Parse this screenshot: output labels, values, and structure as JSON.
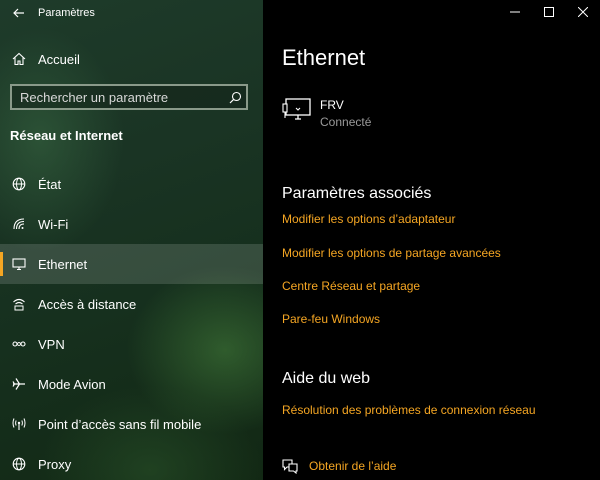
{
  "app": {
    "title": "Paramètres"
  },
  "sidebar": {
    "home_label": "Accueil",
    "search": {
      "placeholder": "Rechercher un paramètre",
      "value": ""
    },
    "section_title": "Réseau et Internet",
    "items": [
      {
        "label": "État",
        "icon": "globe-icon",
        "active": false
      },
      {
        "label": "Wi-Fi",
        "icon": "wifi-icon",
        "active": false
      },
      {
        "label": "Ethernet",
        "icon": "ethernet-icon",
        "active": true
      },
      {
        "label": "Accès à distance",
        "icon": "dialup-icon",
        "active": false
      },
      {
        "label": "VPN",
        "icon": "vpn-icon",
        "active": false
      },
      {
        "label": "Mode Avion",
        "icon": "airplane-icon",
        "active": false
      },
      {
        "label": "Point d’accès sans fil mobile",
        "icon": "hotspot-icon",
        "active": false
      },
      {
        "label": "Proxy",
        "icon": "globe-icon",
        "active": false
      }
    ]
  },
  "main": {
    "page_title": "Ethernet",
    "network": {
      "name": "FRV",
      "status": "Connecté",
      "icon": "network-computer-icon"
    },
    "related": {
      "title": "Paramètres associés",
      "links": [
        "Modifier les options d’adaptateur",
        "Modifier les options de partage avancées",
        "Centre Réseau et partage",
        "Pare-feu Windows"
      ]
    },
    "web_help": {
      "title": "Aide du web",
      "links": [
        "Résolution des problèmes de connexion réseau"
      ]
    },
    "get_help": "Obtenir de l’aide"
  },
  "colors": {
    "accent": "#f5a623",
    "main_bg": "#000000",
    "sidebar_bg": "#1a3424",
    "muted_text": "#9a9a9a"
  }
}
